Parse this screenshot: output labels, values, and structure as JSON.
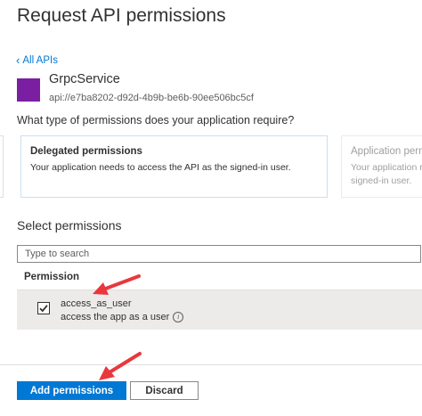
{
  "header": {
    "title": "Request API permissions"
  },
  "nav": {
    "back_label": "All APIs",
    "back_icon": "chevron-left-icon"
  },
  "api": {
    "name": "GrpcService",
    "uri": "api://e7ba8202-d92d-4b9b-be6b-90ee506bc5cf",
    "logo_color": "#7a1fa2"
  },
  "question": "What type of permissions does your application require?",
  "permission_types": [
    {
      "title": "Delegated permissions",
      "description": "Your application needs to access the API as the signed-in user."
    },
    {
      "title": "Application perm",
      "description": "Your application r signed-in user."
    }
  ],
  "select": {
    "label": "Select permissions",
    "search_placeholder": "Type to search",
    "column_header": "Permission",
    "items": [
      {
        "name": "access_as_user",
        "description": "access the app as a user",
        "checked": true,
        "info_icon": "info-icon"
      }
    ]
  },
  "footer": {
    "primary_label": "Add permissions",
    "secondary_label": "Discard",
    "primary_color": "#0078d4"
  },
  "annotations": {
    "arrow_color": "#e8383d"
  }
}
